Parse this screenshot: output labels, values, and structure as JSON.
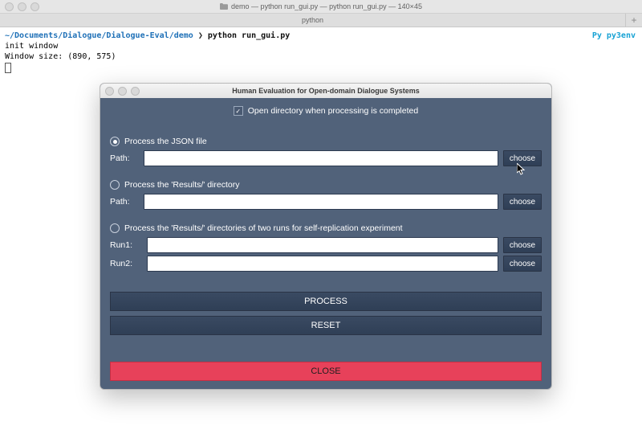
{
  "terminal": {
    "title_text": "demo — python run_gui.py — python run_gui.py — 140×45",
    "tab_text": "python",
    "prompt_path": "~/Documents/Dialogue/Dialogue-Eval/demo",
    "prompt_sep": "❯",
    "command": "python run_gui.py",
    "env_label": "Py py3env",
    "output_line1": "init window",
    "output_line2": "Window size: (890, 575)"
  },
  "gui": {
    "title": "Human Evaluation for Open-domain Dialogue Systems",
    "checkbox_label": "Open directory when processing is completed",
    "checkbox_checked": true,
    "sections": {
      "json": {
        "radio_label": "Process the JSON file",
        "selected": true,
        "path_label": "Path:",
        "path_value": "",
        "choose": "choose"
      },
      "results": {
        "radio_label": "Process the 'Results/' directory",
        "selected": false,
        "path_label": "Path:",
        "path_value": "",
        "choose": "choose"
      },
      "replication": {
        "radio_label": "Process the 'Results/' directories of two runs for self-replication experiment",
        "selected": false,
        "run1_label": "Run1:",
        "run1_value": "",
        "run2_label": "Run2:",
        "run2_value": "",
        "choose": "choose"
      }
    },
    "buttons": {
      "process": "PROCESS",
      "reset": "RESET",
      "close": "CLOSE"
    }
  }
}
